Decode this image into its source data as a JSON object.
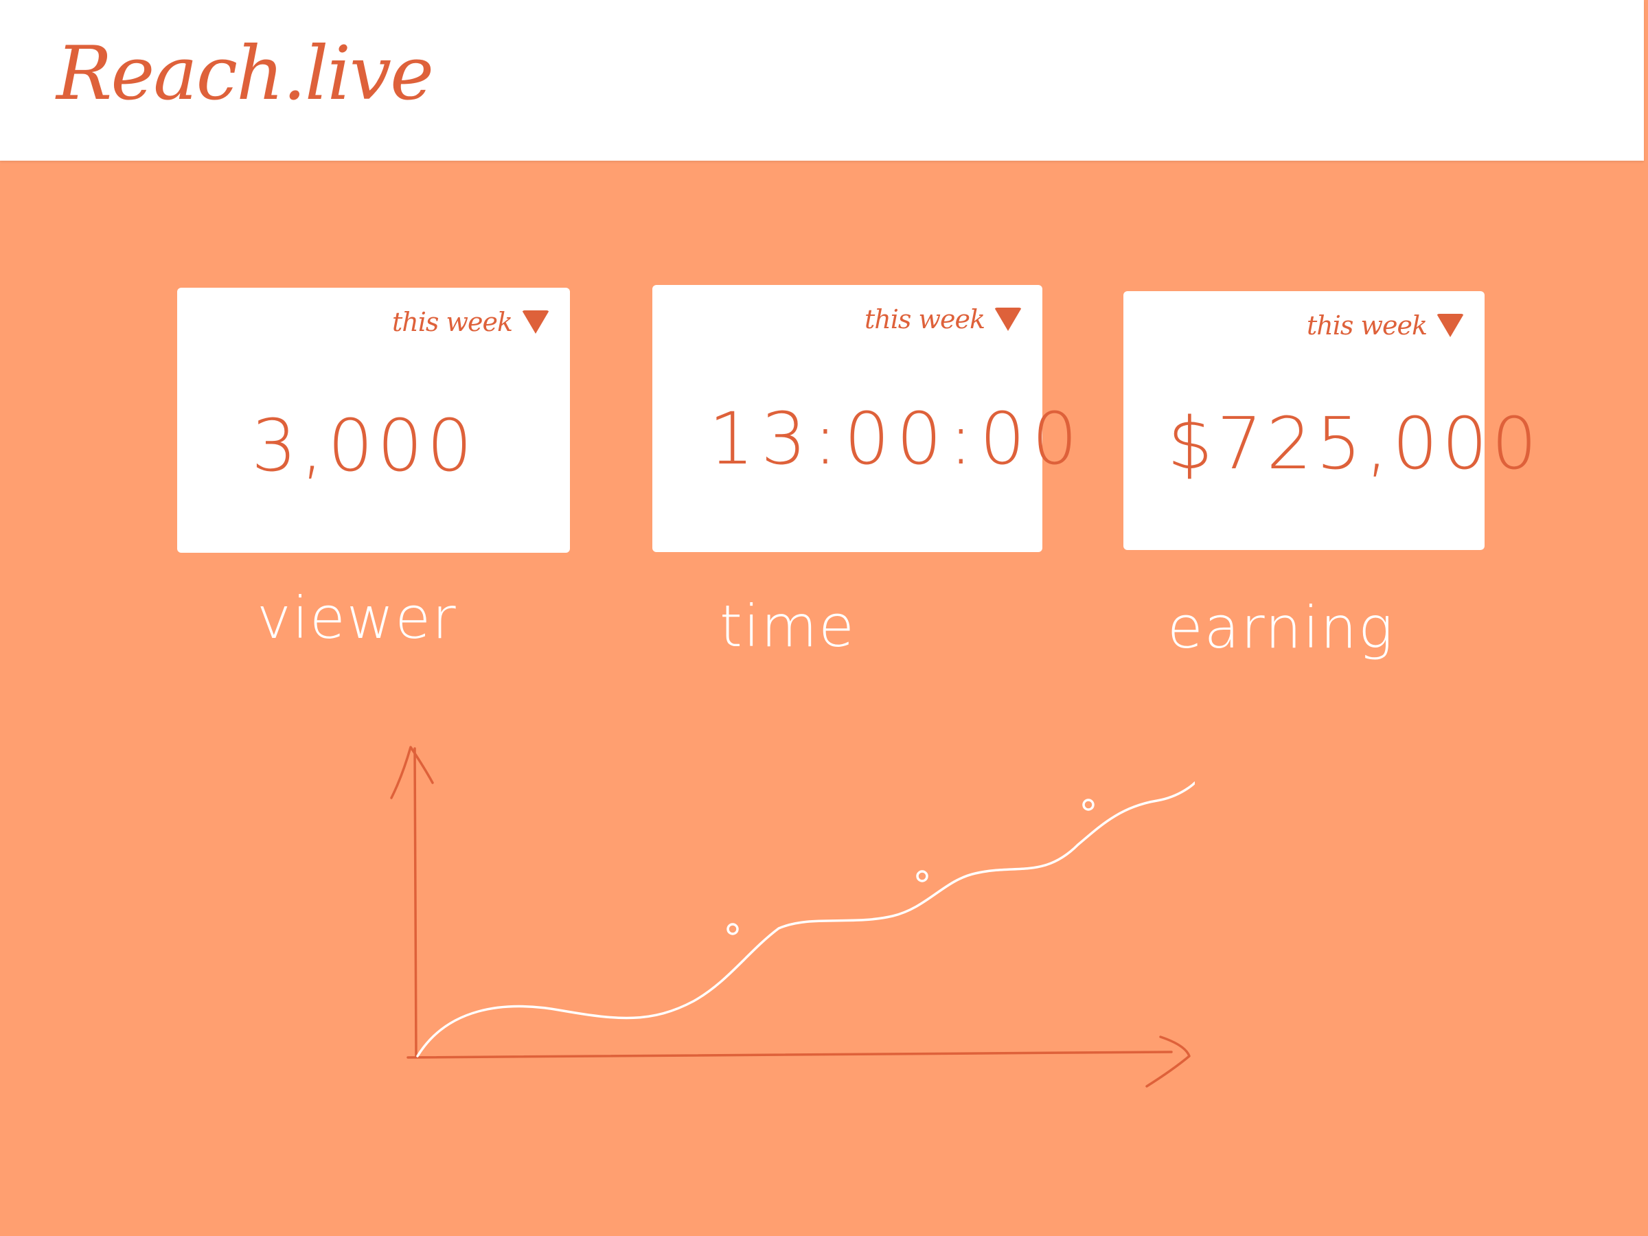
{
  "header": {
    "logo": "Reach.live"
  },
  "stats": [
    {
      "value": "3,000",
      "period": "this week",
      "caption": "viewer"
    },
    {
      "value": "13:00:00",
      "period": "this week",
      "caption": "time"
    },
    {
      "value": "$725,000",
      "period": "this week",
      "caption": "earning"
    }
  ],
  "colors": {
    "background": "#FF9F70",
    "accent": "#DE613A",
    "surface": "#FFFFFF"
  },
  "icons": {
    "period_dropdown": "caret-down-icon"
  }
}
